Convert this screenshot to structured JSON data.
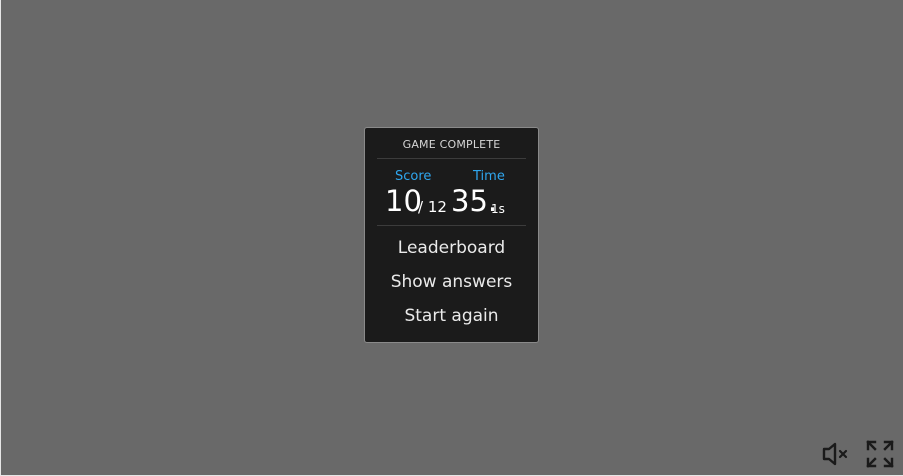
{
  "game_over": {
    "title": "GAME COMPLETE",
    "score_label": "Score",
    "time_label": "Time",
    "score_value": "10",
    "score_total": "/ 12",
    "time_value": "35.",
    "time_fraction": "1s",
    "menu": [
      "Leaderboard",
      "Show answers",
      "Start again"
    ]
  },
  "controls": {
    "mute_icon": "speaker-muted-icon",
    "fullscreen_icon": "fullscreen-icon"
  },
  "colors": {
    "background": "#696969",
    "panel": "#1b1b1b",
    "accent": "#2fa6ee",
    "text": "#ffffff"
  }
}
